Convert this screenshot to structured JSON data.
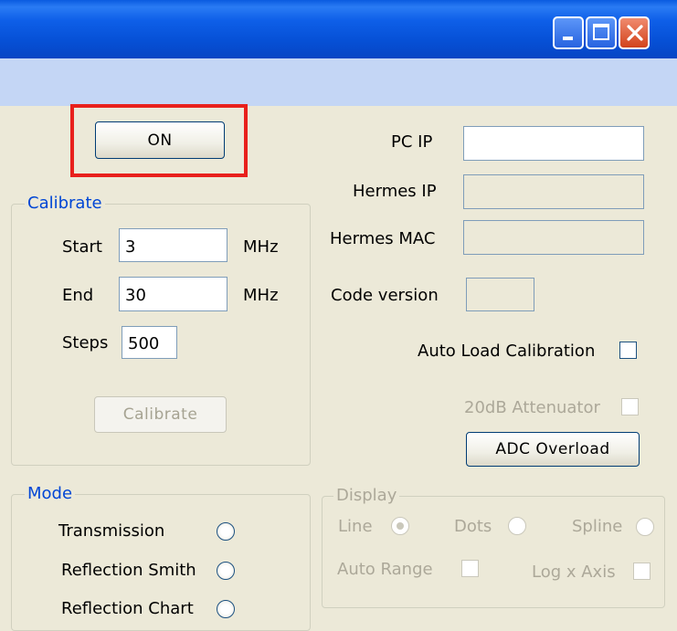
{
  "window": {
    "title": "",
    "controls": {
      "minimize_icon": "minimize-icon",
      "maximize_icon": "maximize-icon",
      "close_icon": "close-icon"
    }
  },
  "power_button": {
    "label": "ON",
    "highlight_color": "#e8201c"
  },
  "calibrate": {
    "title": "Calibrate",
    "start_label": "Start",
    "start_value": "3",
    "start_unit": "MHz",
    "end_label": "End",
    "end_value": "30",
    "end_unit": "MHz",
    "steps_label": "Steps",
    "steps_value": "500",
    "button_label": "Calibrate"
  },
  "network": {
    "pc_ip_label": "PC IP",
    "pc_ip_value": "",
    "hermes_ip_label": "Hermes IP",
    "hermes_ip_value": "",
    "hermes_mac_label": "Hermes MAC",
    "hermes_mac_value": "",
    "code_version_label": "Code version",
    "code_version_value": ""
  },
  "options": {
    "auto_load_label": "Auto Load Calibration",
    "auto_load_checked": false,
    "attenuator_label": "20dB Attenuator",
    "attenuator_checked": false,
    "adc_overload_label": "ADC Overload"
  },
  "mode": {
    "title": "Mode",
    "options": [
      {
        "label": "Transmission",
        "selected": false
      },
      {
        "label": "Reflection Smith",
        "selected": false
      },
      {
        "label": "Reflection Chart",
        "selected": false
      }
    ]
  },
  "display": {
    "title": "Display",
    "line_label": "Line",
    "line_selected": true,
    "dots_label": "Dots",
    "dots_selected": false,
    "spline_label": "Spline",
    "spline_selected": false,
    "auto_range_label": "Auto Range",
    "auto_range_checked": false,
    "log_x_label": "Log x Axis",
    "log_x_checked": false
  },
  "colors": {
    "titlebar": "#0a5be0",
    "menubar": "#c4d6f5",
    "background": "#ece9d8",
    "groupbox_title": "#0046d5"
  }
}
